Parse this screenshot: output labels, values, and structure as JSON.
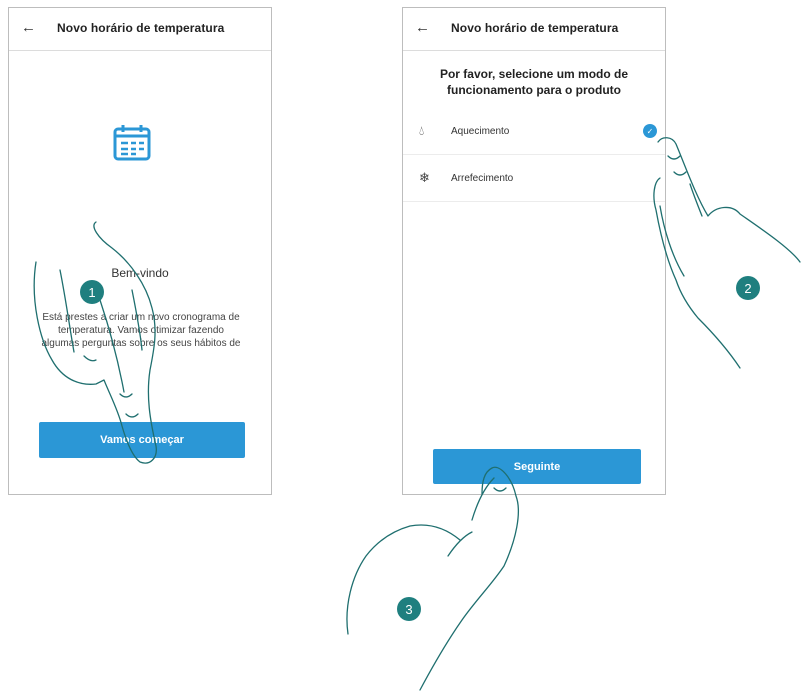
{
  "screen1": {
    "back_icon": "arrow-left-icon",
    "title": "Novo horário de temperatura",
    "welcome": "Bem-vindo",
    "intro_lines": [
      "Está prestes a criar um novo cronograma de",
      "temperatura. Vamos otimizar fazendo",
      "algumas perguntas sobre os seus hábitos de"
    ],
    "start_button": "Vamos começar"
  },
  "screen2": {
    "back_icon": "arrow-left-icon",
    "title": "Novo horário de temperatura",
    "prompt_line1": "Por favor, selecione um modo de",
    "prompt_line2": "funcionamento para o produto",
    "modes": [
      {
        "label": "Aquecimento",
        "icon": "flame-icon",
        "selected": true
      },
      {
        "label": "Arrefecimento",
        "icon": "snowflake-icon",
        "selected": false
      }
    ],
    "next_button": "Seguinte"
  },
  "markers": [
    "1",
    "2",
    "3"
  ],
  "colors": {
    "accent": "#2b97d6",
    "marker": "#1f7f7f",
    "hand_outline": "#1f6f6f"
  }
}
